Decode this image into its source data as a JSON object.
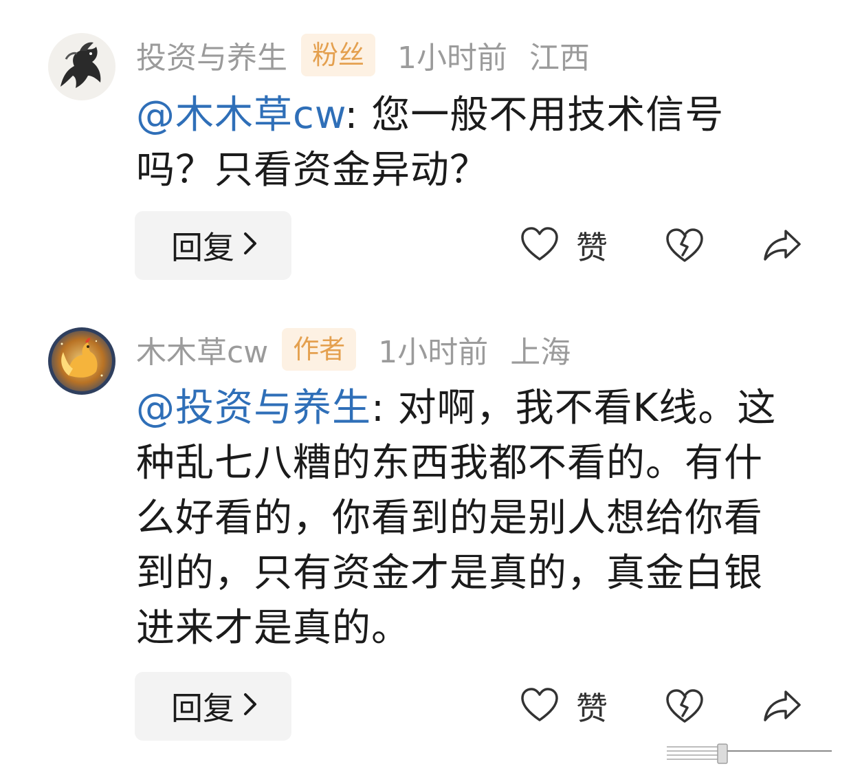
{
  "comments": [
    {
      "username": "投资与养生",
      "badge": "粉丝",
      "time": "1小时前",
      "location": "江西",
      "mention": "@木木草cw",
      "text": ": 您一般不用技术信号吗？只看资金异动？",
      "reply_label": "回复",
      "like_label": "赞",
      "avatar_icon": "horse-ink-painting-avatar"
    },
    {
      "username": "木木草cw",
      "badge": "作者",
      "time": "1小时前",
      "location": "上海",
      "mention": "@投资与养生",
      "text": ": 对啊，我不看K线。这种乱七八糟的东西我都不看的。有什么好看的，你看到的是别人想给你看到的，只有资金才是真的，真金白银进来才是真的。",
      "reply_label": "回复",
      "like_label": "赞",
      "avatar_icon": "golden-rooster-avatar"
    }
  ],
  "colors": {
    "username": "#9b9b9b",
    "mention": "#2f6fb8",
    "badge_bg": "#fdf1e3",
    "badge_text": "#e4a04f",
    "reply_bg": "#f3f3f3"
  },
  "icons": {
    "like": "heart-icon",
    "dislike": "broken-heart-icon",
    "share": "share-arrow-icon",
    "reply_chevron": "chevron-right-icon"
  }
}
